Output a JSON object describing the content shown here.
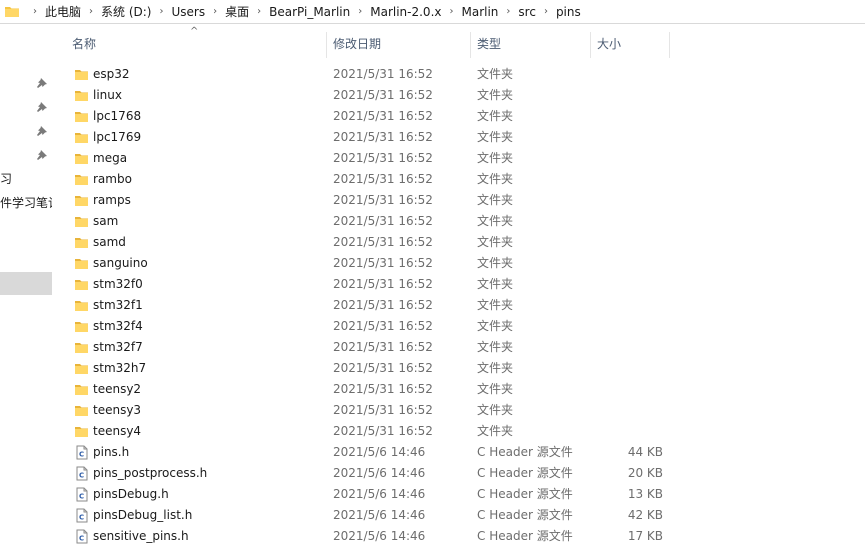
{
  "breadcrumb": [
    "此电脑",
    "系统 (D:)",
    "Users",
    "桌面",
    "BearPi_Marlin",
    "Marlin-2.0.x",
    "Marlin",
    "src",
    "pins"
  ],
  "columns": {
    "name": "名称",
    "date": "修改日期",
    "type": "类型",
    "size": "大小"
  },
  "nav": {
    "item1": "习",
    "item2": "件学习笔记"
  },
  "files": [
    {
      "name": "esp32",
      "date": "2021/5/31 16:52",
      "type": "文件夹",
      "size": "",
      "kind": "folder"
    },
    {
      "name": "linux",
      "date": "2021/5/31 16:52",
      "type": "文件夹",
      "size": "",
      "kind": "folder"
    },
    {
      "name": "lpc1768",
      "date": "2021/5/31 16:52",
      "type": "文件夹",
      "size": "",
      "kind": "folder"
    },
    {
      "name": "lpc1769",
      "date": "2021/5/31 16:52",
      "type": "文件夹",
      "size": "",
      "kind": "folder"
    },
    {
      "name": "mega",
      "date": "2021/5/31 16:52",
      "type": "文件夹",
      "size": "",
      "kind": "folder"
    },
    {
      "name": "rambo",
      "date": "2021/5/31 16:52",
      "type": "文件夹",
      "size": "",
      "kind": "folder"
    },
    {
      "name": "ramps",
      "date": "2021/5/31 16:52",
      "type": "文件夹",
      "size": "",
      "kind": "folder"
    },
    {
      "name": "sam",
      "date": "2021/5/31 16:52",
      "type": "文件夹",
      "size": "",
      "kind": "folder"
    },
    {
      "name": "samd",
      "date": "2021/5/31 16:52",
      "type": "文件夹",
      "size": "",
      "kind": "folder"
    },
    {
      "name": "sanguino",
      "date": "2021/5/31 16:52",
      "type": "文件夹",
      "size": "",
      "kind": "folder"
    },
    {
      "name": "stm32f0",
      "date": "2021/5/31 16:52",
      "type": "文件夹",
      "size": "",
      "kind": "folder"
    },
    {
      "name": "stm32f1",
      "date": "2021/5/31 16:52",
      "type": "文件夹",
      "size": "",
      "kind": "folder"
    },
    {
      "name": "stm32f4",
      "date": "2021/5/31 16:52",
      "type": "文件夹",
      "size": "",
      "kind": "folder"
    },
    {
      "name": "stm32f7",
      "date": "2021/5/31 16:52",
      "type": "文件夹",
      "size": "",
      "kind": "folder"
    },
    {
      "name": "stm32h7",
      "date": "2021/5/31 16:52",
      "type": "文件夹",
      "size": "",
      "kind": "folder"
    },
    {
      "name": "teensy2",
      "date": "2021/5/31 16:52",
      "type": "文件夹",
      "size": "",
      "kind": "folder"
    },
    {
      "name": "teensy3",
      "date": "2021/5/31 16:52",
      "type": "文件夹",
      "size": "",
      "kind": "folder"
    },
    {
      "name": "teensy4",
      "date": "2021/5/31 16:52",
      "type": "文件夹",
      "size": "",
      "kind": "folder"
    },
    {
      "name": "pins.h",
      "date": "2021/5/6 14:46",
      "type": "C Header 源文件",
      "size": "44 KB",
      "kind": "cheader"
    },
    {
      "name": "pins_postprocess.h",
      "date": "2021/5/6 14:46",
      "type": "C Header 源文件",
      "size": "20 KB",
      "kind": "cheader"
    },
    {
      "name": "pinsDebug.h",
      "date": "2021/5/6 14:46",
      "type": "C Header 源文件",
      "size": "13 KB",
      "kind": "cheader"
    },
    {
      "name": "pinsDebug_list.h",
      "date": "2021/5/6 14:46",
      "type": "C Header 源文件",
      "size": "42 KB",
      "kind": "cheader"
    },
    {
      "name": "sensitive_pins.h",
      "date": "2021/5/6 14:46",
      "type": "C Header 源文件",
      "size": "17 KB",
      "kind": "cheader"
    }
  ]
}
